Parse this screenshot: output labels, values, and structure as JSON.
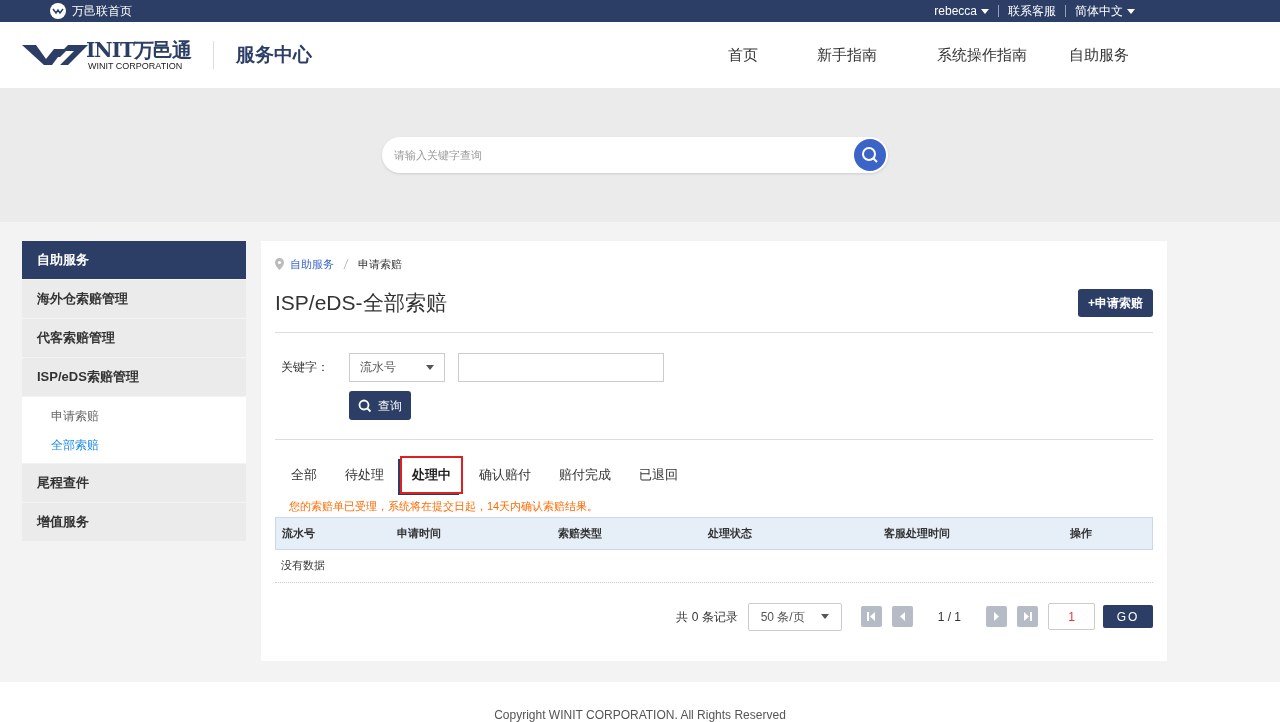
{
  "top_bar": {
    "home_link": "万邑联首页",
    "user": "rebecca",
    "contact": "联系客服",
    "language": "简体中文"
  },
  "header": {
    "logo_text": "INIT万邑通",
    "logo_subtext": "WINIT CORPORATION",
    "site_title": "服务中心",
    "nav": [
      {
        "label": "首页"
      },
      {
        "label": "新手指南"
      },
      {
        "label": "系统操作指南"
      },
      {
        "label": "自助服务"
      }
    ]
  },
  "search": {
    "placeholder": "请输入关键字查询"
  },
  "sidebar": {
    "title": "自助服务",
    "items": [
      {
        "label": "海外仓索赔管理"
      },
      {
        "label": "代客索赔管理"
      },
      {
        "label": "ISP/eDS索赔管理",
        "children": [
          {
            "label": "申请索赔",
            "selected": false
          },
          {
            "label": "全部索赔",
            "selected": true
          }
        ]
      },
      {
        "label": "尾程查件"
      },
      {
        "label": "增值服务"
      }
    ]
  },
  "breadcrumb": [
    {
      "label": "自助服务"
    },
    {
      "label": "申请索赔"
    }
  ],
  "page_title": "ISP/eDS-全部索赔",
  "new_claim_button": "+申请索赔",
  "filter": {
    "label": "关键字：",
    "select_value": "流水号",
    "search_button": "查询"
  },
  "tabs": [
    {
      "label": "全部",
      "selected": false
    },
    {
      "label": "待处理",
      "selected": false
    },
    {
      "label": "处理中",
      "selected": true
    },
    {
      "label": "确认赔付",
      "selected": false
    },
    {
      "label": "赔付完成",
      "selected": false
    },
    {
      "label": "已退回",
      "selected": false
    }
  ],
  "notice": "您的索赔单已受理，系统将在提交日起，14天内确认索赔结果。",
  "table": {
    "columns": [
      "流水号",
      "申请时间",
      "索赔类型",
      "处理状态",
      "客服处理时间",
      "操作"
    ],
    "empty_text": "没有数据"
  },
  "pagination": {
    "total": "共 0 条记录",
    "page_size": "50 条/页",
    "page_info": "1 / 1",
    "page_input": "1",
    "go_button": "GO"
  },
  "footer": "Copyright WINIT CORPORATION. All Rights Reserved"
}
